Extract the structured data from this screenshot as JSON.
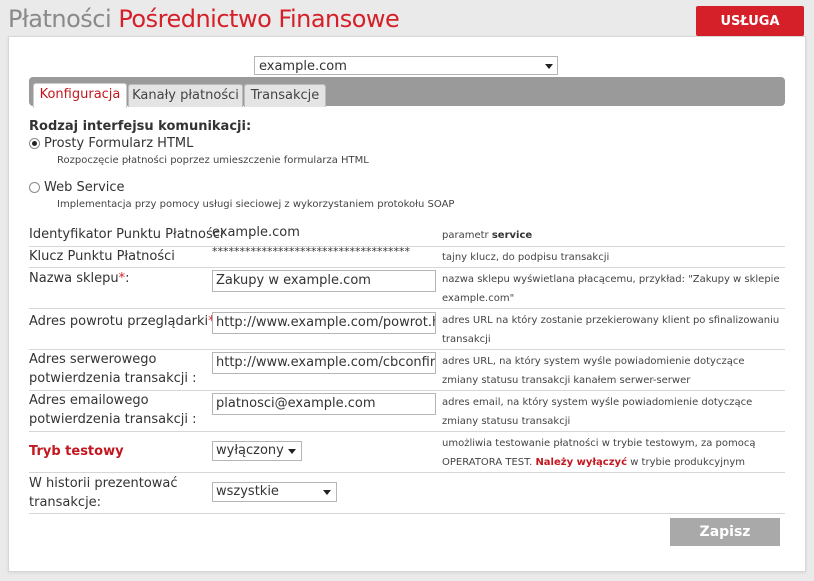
{
  "header": {
    "title_part1": "Płatności",
    "title_part2": "Pośrednictwo Finansowe",
    "service_badge": "USŁUGA"
  },
  "site_select": {
    "value": "example.com"
  },
  "tabs": [
    {
      "label": "Konfiguracja",
      "active": true
    },
    {
      "label": "Kanały płatności",
      "active": false
    },
    {
      "label": "Transakcje",
      "active": false
    }
  ],
  "interface": {
    "title": "Rodzaj interfejsu komunikacji:",
    "options": [
      {
        "label": "Prosty Formularz HTML",
        "desc": "Rozpoczęcie płatności poprzez umieszczenie formularza HTML",
        "selected": true
      },
      {
        "label": "Web Service",
        "desc": "Implementacja przy pomocy usługi sieciowej z wykorzystaniem protokołu SOAP",
        "selected": false
      }
    ]
  },
  "fields": {
    "pos_id": {
      "label": "Identyfikator Punktu Płatności",
      "value": "example.com",
      "note_prefix": "parametr",
      "note_bold": "service"
    },
    "pos_key": {
      "label": "Klucz Punktu Płatności",
      "value": "************************************",
      "note": "tajny klucz, do podpisu transakcji"
    },
    "shop_name": {
      "label": "Nazwa sklepu",
      "required": "*",
      "suffix": ":",
      "value": "Zakupy w example.com",
      "note": "nazwa sklepu wyświetlana płacącemu, przykład: \"Zakupy w sklepie example.com\""
    },
    "return_url": {
      "label": "Adres powrotu przeglądarki",
      "required": "*",
      "suffix": ":",
      "value": "http://www.example.com/powrot.html",
      "note": "adres URL na który zostanie przekierowany klient po sfinalizowaniu transakcji"
    },
    "server_confirm": {
      "label_line1": "Adres serwerowego",
      "label_line2": "potwierdzenia transakcji :",
      "value": "http://www.example.com/cbconfirm.php",
      "note": "adres URL, na który system wyśle powiadomienie dotyczące zmiany statusu transakcji kanałem serwer-serwer"
    },
    "email_confirm": {
      "label_line1": "Adres emailowego",
      "label_line2": "potwierdzenia transakcji :",
      "value": "platnosci@example.com",
      "note": "adres email, na który system wyśle powiadomienie dotyczące zmiany statusu transakcji"
    },
    "test_mode": {
      "label": "Tryb testowy",
      "value": "wyłączony",
      "note_part1": "umożliwia testowanie płatności w trybie testowym, za pomocą OPERATORA TEST.",
      "note_warn": "Należy wyłączyć",
      "note_part2": "w trybie produkcyjnym"
    },
    "history": {
      "label_line1": "W historii prezentować",
      "label_line2": "transakcje:",
      "value": "wszystkie"
    }
  },
  "save_label": "Zapisz",
  "colors": {
    "brand_red": "#d51f29",
    "tab_bar": "#9a9a9a",
    "save_button": "#a9a9a9"
  }
}
